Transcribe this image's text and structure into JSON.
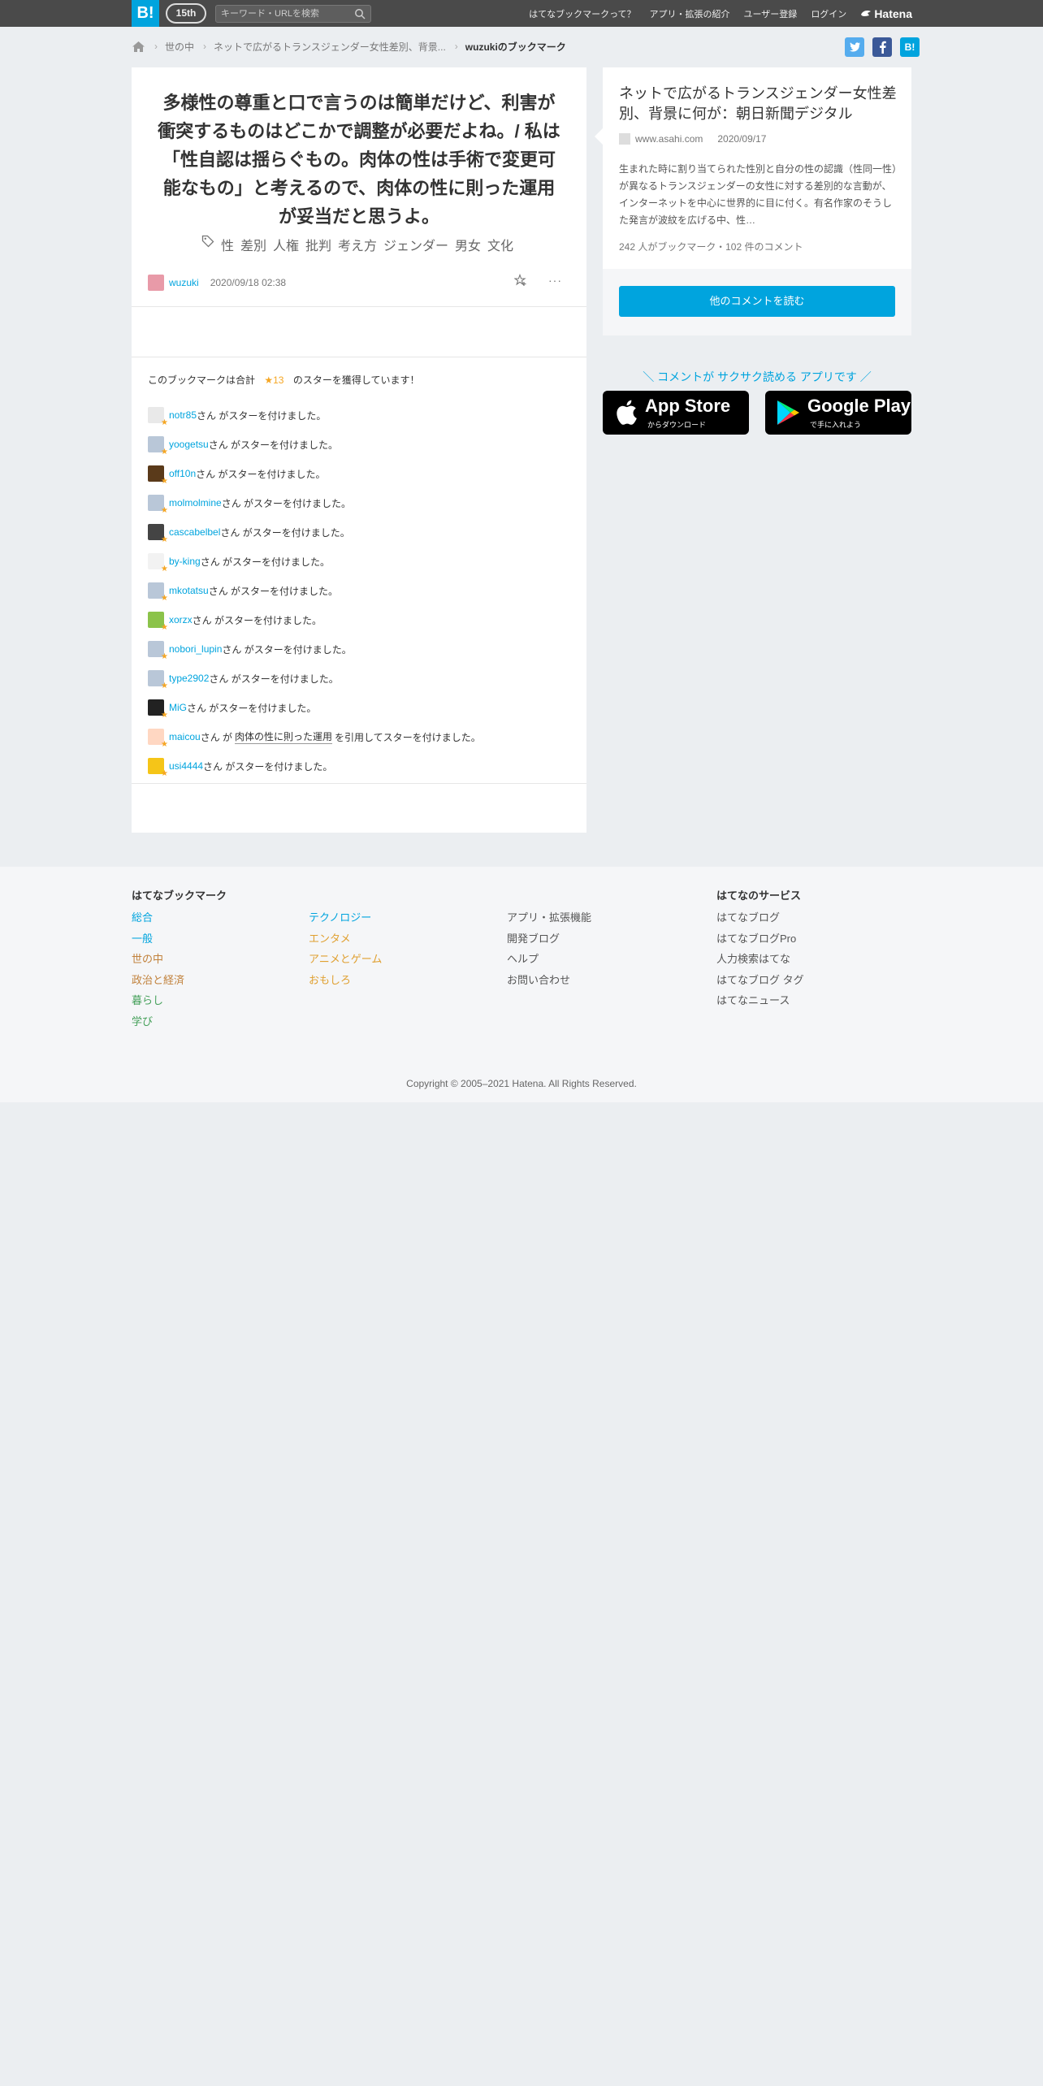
{
  "header": {
    "logo": "B!",
    "anniversary": "15th",
    "search_placeholder": "キーワード・URLを検索",
    "nav": [
      "はてなブックマークって？",
      "アプリ・拡張の紹介",
      "ユーザー登録",
      "ログイン"
    ],
    "brand": "Hatena"
  },
  "breadcrumb": [
    "世の中",
    "ネットで広がるトランスジェンダー女性差別、背景...",
    "wuzukiのブックマーク"
  ],
  "comment": {
    "text": "多様性の尊重と口で言うのは簡単だけど、利害が衝突するものはどこかで調整が必要だよね。/ 私は「性自認は揺らぐもの。肉体の性は手術で変更可能なもの」と考えるので、肉体の性に則った運用が妥当だと思うよ。",
    "tags": [
      "性",
      "差別",
      "人権",
      "批判",
      "考え方",
      "ジェンダー",
      "男女",
      "文化"
    ],
    "user": "wuzuki",
    "timestamp": "2020/09/18 02:38"
  },
  "stars": {
    "summary_prefix": "このブックマークは合計",
    "count": "★13",
    "summary_suffix": "のスターを獲得しています！",
    "items": [
      {
        "user": "notr85",
        "text": "さん がスターを付けました。",
        "color": "#e9e9e9"
      },
      {
        "user": "yoogetsu",
        "text": "さん がスターを付けました。",
        "color": "#b9c7d8"
      },
      {
        "user": "off10n",
        "text": "さん がスターを付けました。",
        "color": "#5a3a1a"
      },
      {
        "user": "molmolmine",
        "text": "さん がスターを付けました。",
        "color": "#b9c7d8"
      },
      {
        "user": "cascabelbel",
        "text": "さん がスターを付けました。",
        "color": "#444444"
      },
      {
        "user": "by-king",
        "text": "さん がスターを付けました。",
        "color": "#f2f2f2"
      },
      {
        "user": "mkotatsu",
        "text": "さん がスターを付けました。",
        "color": "#b9c7d8"
      },
      {
        "user": "xorzx",
        "text": "さん がスターを付けました。",
        "color": "#8bc34a"
      },
      {
        "user": "nobori_lupin",
        "text": "さん がスターを付けました。",
        "color": "#b9c7d8"
      },
      {
        "user": "type2902",
        "text": "さん がスターを付けました。",
        "color": "#b9c7d8"
      },
      {
        "user": "MiG",
        "text": "さん がスターを付けました。",
        "color": "#222222"
      },
      {
        "user": "maicou",
        "text_before": "さん が",
        "quote": "肉体の性に則った運用",
        "text_after": "を引用してスターを付けました。",
        "color": "#ffd7c2"
      },
      {
        "user": "usi4444",
        "text": "さん がスターを付けました。",
        "color": "#f5c518"
      }
    ]
  },
  "entry": {
    "title": "ネットで広がるトランスジェンダー女性差別、背景に何が：朝日新聞デジタル",
    "domain": "www.asahi.com",
    "date": "2020/09/17",
    "description": "生まれた時に割り当てられた性別と自分の性の認識（性同一性）が異なるトランスジェンダーの女性に対する差別的な言動が、インターネットを中心に世界的に目に付く。有名作家のそうした発言が波紋を広げる中、性…",
    "stats": "242 人がブックマーク・102 件のコメント",
    "read_more": "他のコメントを読む"
  },
  "app_promo": {
    "text": "＼ コメントが サクサク読める アプリです ／",
    "app_store": {
      "big": "App Store",
      "small": "からダウンロード"
    },
    "google_play": {
      "big": "Google Play",
      "small": "で手に入れよう"
    }
  },
  "footer": {
    "col1_title": "はてなブックマーク",
    "col1": [
      {
        "label": "総合",
        "color": "#00a4de"
      },
      {
        "label": "一般",
        "color": "#00a4de"
      },
      {
        "label": "世の中",
        "color": "#c1813b"
      },
      {
        "label": "政治と経済",
        "color": "#c1813b"
      },
      {
        "label": "暮らし",
        "color": "#45a05a"
      },
      {
        "label": "学び",
        "color": "#45a05a"
      }
    ],
    "col2": [
      {
        "label": "テクノロジー",
        "color": "#00a4de"
      },
      {
        "label": "エンタメ",
        "color": "#e0a030"
      },
      {
        "label": "アニメとゲーム",
        "color": "#e0a030"
      },
      {
        "label": "おもしろ",
        "color": "#e0a030"
      }
    ],
    "col3": [
      "アプリ・拡張機能",
      "開発ブログ",
      "ヘルプ",
      "お問い合わせ"
    ],
    "col4_title": "はてなのサービス",
    "col4": [
      "はてなブログ",
      "はてなブログPro",
      "人力検索はてな",
      "はてなブログ タグ",
      "はてなニュース"
    ],
    "copyright": "Copyright © 2005–2021 Hatena. All Rights Reserved."
  }
}
